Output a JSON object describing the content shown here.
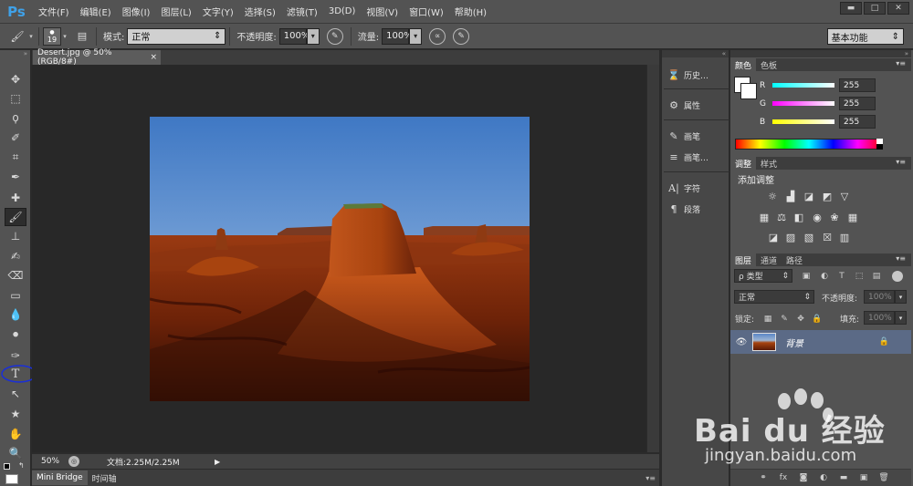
{
  "app": {
    "logo": "Ps"
  },
  "menubar": {
    "items": [
      "文件(F)",
      "编辑(E)",
      "图像(I)",
      "图层(L)",
      "文字(Y)",
      "选择(S)",
      "滤镜(T)",
      "3D(D)",
      "视图(V)",
      "窗口(W)",
      "帮助(H)"
    ],
    "window_controls": [
      "▬",
      "□",
      "✕"
    ]
  },
  "options_bar": {
    "brush_size": "19",
    "mode_label": "模式:",
    "mode_value": "正常",
    "opacity_label": "不透明度:",
    "opacity_value": "100%",
    "flow_label": "流量:",
    "flow_value": "100%",
    "workspace": "基本功能"
  },
  "document": {
    "tab_title": "Desert.jpg @ 50%(RGB/8#)",
    "tab_close": "×",
    "zoom": "50%",
    "doc_info": "文档:2.25M/2.25M",
    "bottom_tabs": [
      "Mini Bridge",
      "时间轴"
    ]
  },
  "mid_dock": {
    "items": [
      "历史…",
      "属性",
      "画笔",
      "画笔…",
      "字符",
      "段落"
    ]
  },
  "color_panel": {
    "tabs": [
      "颜色",
      "色板"
    ],
    "r_label": "R",
    "g_label": "G",
    "b_label": "B",
    "r_value": "255",
    "g_value": "255",
    "b_value": "255"
  },
  "adjust_panel": {
    "tabs": [
      "调整",
      "样式"
    ],
    "title": "添加调整"
  },
  "layers_panel": {
    "tabs": [
      "图层",
      "通道",
      "路径"
    ],
    "filter_label": "ρ 类型",
    "blend_mode": "正常",
    "opacity_label": "不透明度:",
    "opacity_value": "100%",
    "lock_label": "锁定:",
    "fill_label": "填充:",
    "fill_value": "100%",
    "layer_name": "背景"
  },
  "watermark": {
    "brand": "Bai du 经验",
    "url": "jingyan.baidu.com"
  },
  "colors": {
    "accent_blue": "#3fa1e8",
    "layer_selected": "#5b6a86",
    "annotation_blue": "#1a2fd8"
  }
}
